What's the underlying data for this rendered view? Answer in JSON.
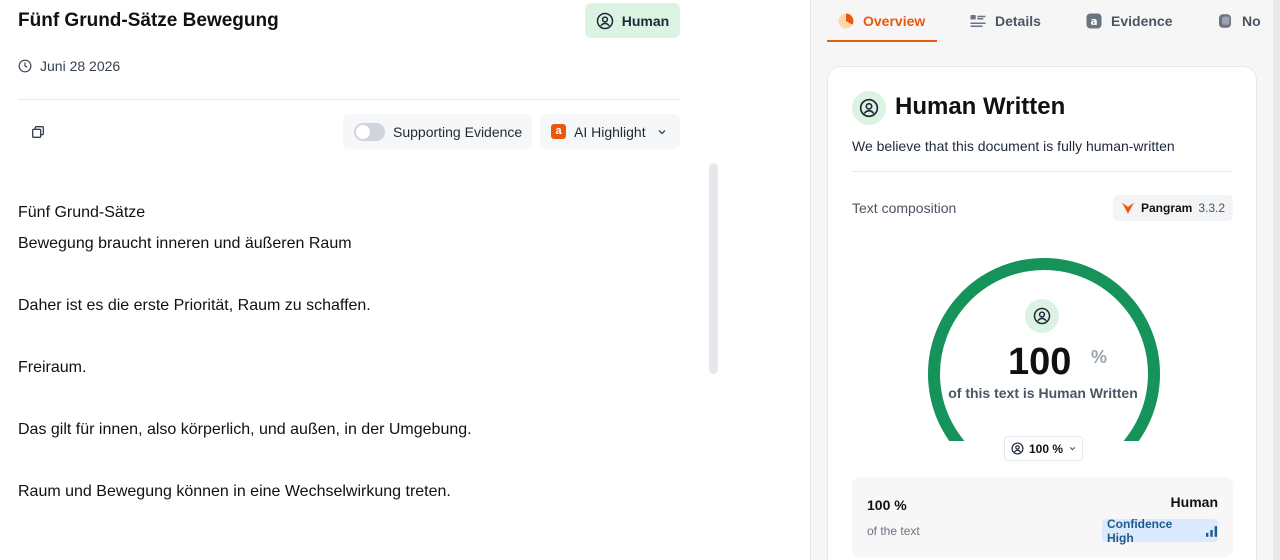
{
  "document": {
    "title": "Fünf Grund-Sätze Bewegung",
    "badge_label": "Human",
    "date": "Juni 28 2026",
    "toolbar": {
      "supporting_evidence_label": "Supporting Evidence",
      "ai_highlight_label": "AI Highlight",
      "ai_icon_letter": "a"
    },
    "paragraphs": [
      "Fünf Grund-Sätze",
      "Bewegung braucht inneren und äußeren Raum",
      "",
      "Daher ist es die erste Priorität, Raum zu schaffen.",
      "",
      "Freiraum.",
      "",
      "Das gilt für innen, also körperlich, und außen, in der Umgebung.",
      "",
      "Raum und Bewegung können in eine Wechselwirkung treten."
    ]
  },
  "tabs": [
    {
      "label": "Overview",
      "icon": "overview-icon",
      "active": true
    },
    {
      "label": "Details",
      "icon": "details-icon",
      "active": false
    },
    {
      "label": "Evidence",
      "icon": "evidence-icon",
      "active": false
    },
    {
      "label": "No",
      "icon": "notes-icon",
      "active": false
    }
  ],
  "result": {
    "title": "Human Written",
    "description": "We believe that this document is fully human-written",
    "composition_label": "Text composition",
    "model_name": "Pangram",
    "model_version": "3.3.2",
    "percent_value": "100",
    "percent_unit": "%",
    "gauge_fraction": 1.0,
    "gauge_caption": "of this text is Human Written",
    "selector_value": "100 %",
    "summary_percent": "100 %",
    "summary_of": "of the text",
    "summary_label": "Human",
    "confidence_label": "Confidence High"
  },
  "colors": {
    "accent": "#ea580c",
    "human_green": "#15935a",
    "human_bg": "#dcf3e3",
    "confidence_bg": "#dbeafe"
  }
}
